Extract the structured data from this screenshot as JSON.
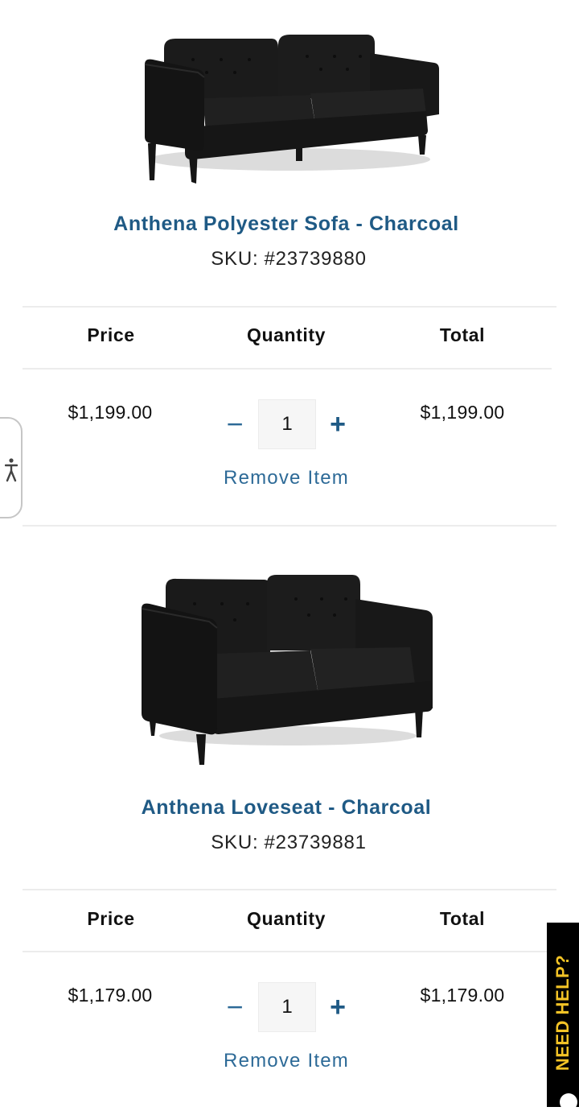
{
  "cart": {
    "headers": {
      "price": "Price",
      "quantity": "Quantity",
      "total": "Total"
    },
    "sku_label": "SKU:",
    "remove_label": "Remove Item",
    "minus_symbol": "−",
    "plus_symbol": "+",
    "items": [
      {
        "name": "Anthena Polyester Sofa - Charcoal",
        "sku": "#23739880",
        "price": "$1,199.00",
        "quantity": "1",
        "total": "$1,199.00",
        "image_icon": "sofa-image"
      },
      {
        "name": "Anthena Loveseat - Charcoal",
        "sku": "#23739881",
        "price": "$1,179.00",
        "quantity": "1",
        "total": "$1,179.00",
        "image_icon": "loveseat-image"
      }
    ]
  },
  "widgets": {
    "need_help_label": "NEED HELP?",
    "accessibility_icon": "accessibility-icon"
  },
  "colors": {
    "link_blue": "#1f5a85",
    "need_help_bg": "#000000",
    "need_help_text": "#f3c326",
    "divider": "#ececec"
  }
}
